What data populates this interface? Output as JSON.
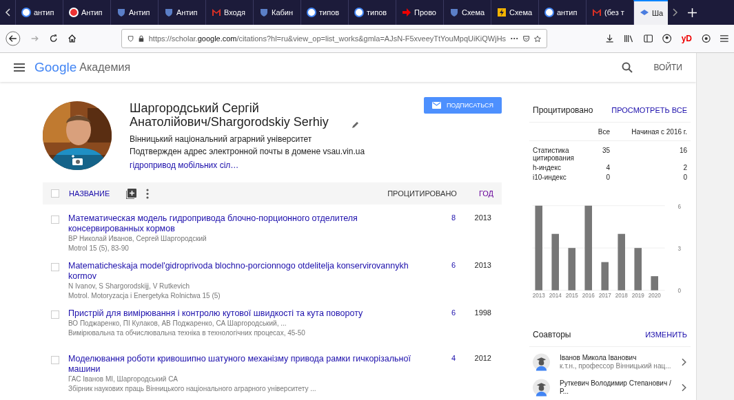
{
  "browser": {
    "tabs": [
      {
        "label": "антип",
        "kind": "g",
        "selected": false
      },
      {
        "label": "Антип",
        "kind": "c",
        "selected": false
      },
      {
        "label": "Антип",
        "kind": "shield",
        "selected": false
      },
      {
        "label": "Антип",
        "kind": "shield",
        "selected": false
      },
      {
        "label": "Входя",
        "kind": "m",
        "selected": false
      },
      {
        "label": "Кабин",
        "kind": "shield",
        "selected": false
      },
      {
        "label": "типов",
        "kind": "g",
        "selected": false
      },
      {
        "label": "типов",
        "kind": "g",
        "selected": false
      },
      {
        "label": "Прово",
        "kind": "arrow",
        "selected": false
      },
      {
        "label": "Схема",
        "kind": "shield",
        "selected": false
      },
      {
        "label": "Схема",
        "kind": "bolt",
        "selected": false
      },
      {
        "label": "антип",
        "kind": "g",
        "selected": false
      },
      {
        "label": "(без т",
        "kind": "m",
        "selected": false
      },
      {
        "label": "Ша",
        "kind": "cap",
        "selected": true
      }
    ],
    "url": {
      "prefix": "https://scholar.",
      "domain": "google.com",
      "rest": "/citations?hl=ru&view_op=list_works&gmla=AJsN-F5xveeyTtYouMpqUiKiQWjHs"
    },
    "ext_label": "yD"
  },
  "header": {
    "logo": "Google",
    "product": "Академия",
    "login": "ВОЙТИ"
  },
  "profile": {
    "name": "Шаргородський Сергій Анатолійович/Shargorodskiy Serhiy",
    "affiliation": "Вінницький національний аграрний університет",
    "email_note": "Подтвержден адрес электронной почты в домене vsau.vin.ua",
    "interests": "гідропривод мобільних сіл…",
    "follow": "ПОДПИСАТЬСЯ"
  },
  "table": {
    "select_all_checked": false,
    "columns": {
      "title": "НАЗВАНИЕ",
      "cited": "ПРОЦИТИРОВАНО",
      "year": "ГОД"
    },
    "rows": [
      {
        "title": "Математическая модель гидропривода блочно-порционного отделителя консервированных кормов",
        "authors": "ВР Николай Иванов, Сергей Шаргородский",
        "venue": "Motrol 15 (5), 83-90",
        "cited": "8",
        "year": "2013",
        "checked": false
      },
      {
        "title": "Matematicheskaja model'gidroprivoda blochno-porcionnogo otdelitelja konservirovannykh kormov",
        "authors": "N Ivanov, S Shargorodskijj, V Rutkevich",
        "venue": "Motrol. Motoryzacja i Energetyka Rolnictwa 15 (5)",
        "cited": "6",
        "year": "2013",
        "checked": false
      },
      {
        "title": "Пристрій для вимірювання і контролю кутової швидкості та кута повороту",
        "authors": "ВО Поджаренко, ПІ Кулаков, АВ Поджаренко, СА Шаргородський, ...",
        "venue": "Вимірювальна та обчислювальна техніка в технологічних процесах, 45-50",
        "cited": "6",
        "year": "1998",
        "checked": false
      },
      {
        "title": "Моделювання роботи кривошипно шатуного механізму привода рамки гичкорізальної машини",
        "authors": "ГАС Іванов МІ, Шаргородський СА",
        "venue": "Збірник наукових праць Вінницького національного аграрного університету ...",
        "cited": "4",
        "year": "2012",
        "checked": false
      }
    ]
  },
  "citations": {
    "title": "Процитировано",
    "view_all": "ПРОСМОТРЕТЬ ВСЕ",
    "col_all": "Все",
    "col_since": "Начиная с 2016 г.",
    "stats": [
      {
        "label": "Статистика цитирования",
        "all": "35",
        "since": "16"
      },
      {
        "label": "h-индекс",
        "all": "4",
        "since": "2"
      },
      {
        "label": "i10-индекс",
        "all": "0",
        "since": "0"
      }
    ],
    "chart_data": {
      "type": "bar",
      "categories": [
        "2013",
        "2014",
        "2015",
        "2016",
        "2017",
        "2018",
        "2019",
        "2020"
      ],
      "values": [
        6,
        4,
        3,
        6,
        2,
        4,
        3,
        1
      ],
      "ylim": [
        0,
        6
      ],
      "yticks": [
        0,
        3,
        6
      ]
    }
  },
  "coauthors": {
    "title": "Соавторы",
    "edit": "ИЗМЕНИТЬ",
    "items": [
      {
        "name": "Іванов Микола Іванович",
        "detail": "к.т.н., профессор Вінницький нац..."
      },
      {
        "name": "Руткевич Володимир Степанович / Р..."
      }
    ]
  }
}
